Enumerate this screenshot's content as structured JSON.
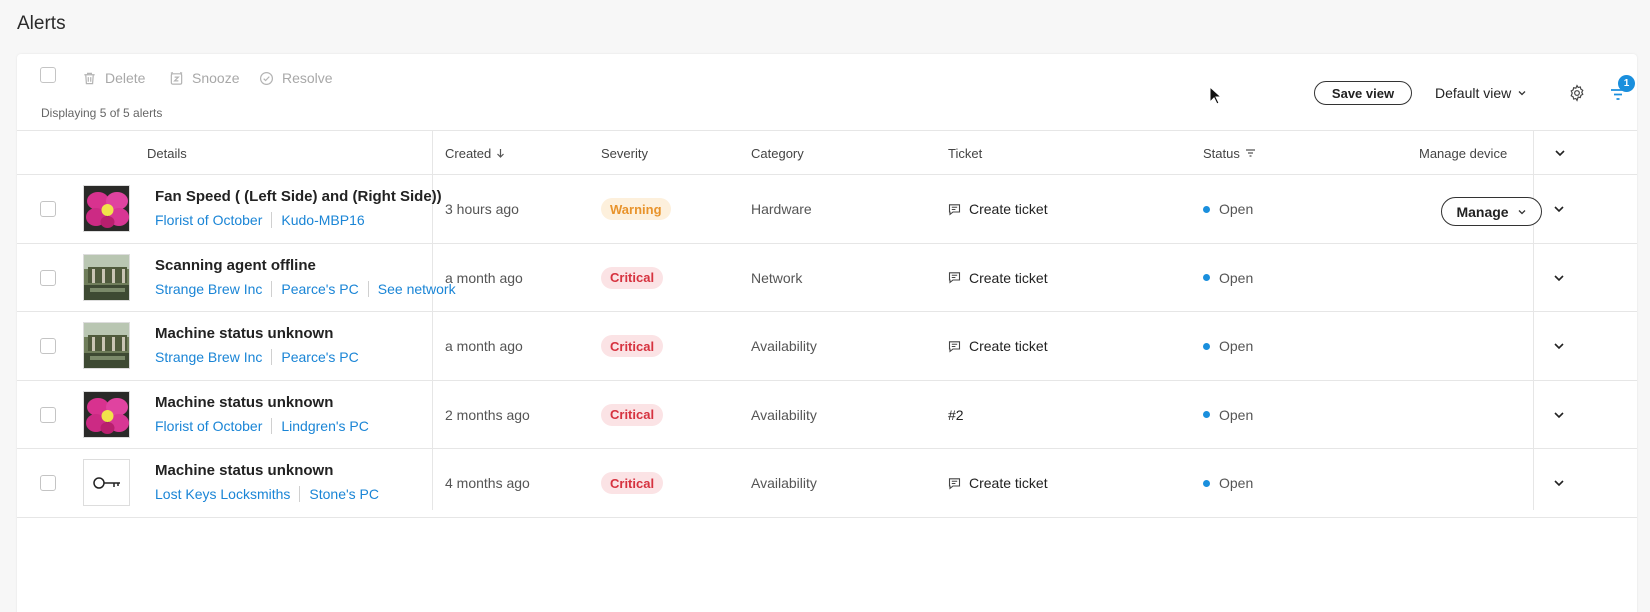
{
  "page": {
    "title": "Alerts"
  },
  "toolbar": {
    "delete_label": "Delete",
    "snooze_label": "Snooze",
    "resolve_label": "Resolve",
    "count_text": "Displaying 5 of 5 alerts",
    "save_view_label": "Save view",
    "default_view_label": "Default view",
    "filter_badge_count": "1"
  },
  "table": {
    "columns": {
      "details": "Details",
      "created": "Created",
      "severity": "Severity",
      "category": "Category",
      "ticket": "Ticket",
      "status": "Status",
      "manage_device": "Manage device"
    },
    "rows": [
      {
        "thumb": "orchid",
        "title": "Fan Speed ( (Left Side) and (Right Side))",
        "links": [
          "Florist of October",
          "Kudo-MBP16"
        ],
        "created": "3 hours ago",
        "severity": "Warning",
        "category": "Hardware",
        "ticket": "Create ticket",
        "status": "Open",
        "manage": "Manage"
      },
      {
        "thumb": "garden",
        "title": "Scanning agent offline",
        "links": [
          "Strange Brew Inc",
          "Pearce's PC",
          "See network"
        ],
        "created": "a month ago",
        "severity": "Critical",
        "category": "Network",
        "ticket": "Create ticket",
        "status": "Open"
      },
      {
        "thumb": "garden",
        "title": "Machine status unknown",
        "links": [
          "Strange Brew Inc",
          "Pearce's PC"
        ],
        "created": "a month ago",
        "severity": "Critical",
        "category": "Availability",
        "ticket": "Create ticket",
        "status": "Open"
      },
      {
        "thumb": "orchid",
        "title": "Machine status unknown",
        "links": [
          "Florist of October",
          "Lindgren's PC"
        ],
        "created": "2 months ago",
        "severity": "Critical",
        "category": "Availability",
        "ticket": "#2",
        "status": "Open"
      },
      {
        "thumb": "key",
        "title": "Machine status unknown",
        "links": [
          "Lost Keys Locksmiths",
          "Stone's PC"
        ],
        "created": "4 months ago",
        "severity": "Critical",
        "category": "Availability",
        "ticket": "Create ticket",
        "status": "Open"
      }
    ]
  },
  "colors": {
    "link": "#1a85d6",
    "warning_text": "#e8932b",
    "warning_bg": "#fdf0dc",
    "critical_text": "#d6323f",
    "critical_bg": "#fbe3e5",
    "status_open": "#1a8fdd"
  },
  "icons": {
    "delete": "trash-icon",
    "snooze": "alarm-clock-icon",
    "resolve": "check-circle-icon",
    "settings": "gear-icon",
    "filter": "filter-icon",
    "ticket": "comment-icon",
    "expand": "chevron-down-icon"
  }
}
